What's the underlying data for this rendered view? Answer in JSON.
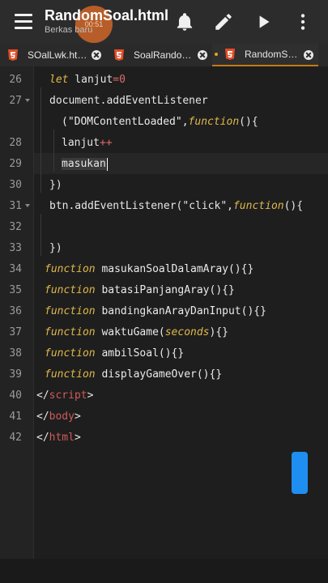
{
  "appbar": {
    "title": "RandomSoal.html",
    "subtitle": "Berkas baru",
    "timer": "00:51"
  },
  "tabs": [
    {
      "label": "SOalLwk.ht…",
      "active": false
    },
    {
      "label": "SoalRando…",
      "active": false
    },
    {
      "label": "RandomS…",
      "active": true
    }
  ],
  "lines": [
    {
      "n": "26"
    },
    {
      "n": "27"
    },
    {
      "n": ""
    },
    {
      "n": "28"
    },
    {
      "n": "29"
    },
    {
      "n": "30"
    },
    {
      "n": "31"
    },
    {
      "n": "32"
    },
    {
      "n": "33"
    },
    {
      "n": "34"
    },
    {
      "n": "35"
    },
    {
      "n": "36"
    },
    {
      "n": "37"
    },
    {
      "n": "38"
    },
    {
      "n": "39"
    },
    {
      "n": "40"
    },
    {
      "n": "41"
    },
    {
      "n": "42"
    }
  ],
  "code": {
    "l26": {
      "kw": "let",
      "name": " lanjut",
      "op": "=",
      "num": "0"
    },
    "l27": {
      "obj": "document.addEventListener"
    },
    "l27b": {
      "str": "(\"DOMContentLoaded\",",
      "kw": "function",
      "rest": "(){"
    },
    "l28": {
      "name": "lanjut",
      "op": "++"
    },
    "l29": {
      "name": "masukan"
    },
    "l30": {
      "text": "})"
    },
    "l31": {
      "pre": "btn.addEventListener(\"click\",",
      "kw": "function",
      "rest": "(){"
    },
    "l33": {
      "text": "})"
    },
    "l34": {
      "kw": "function",
      "name": " masukanSoalDalamAray(){}"
    },
    "l35": {
      "kw": "function",
      "name": " batasiPanjangAray(){}"
    },
    "l36": {
      "kw": "function",
      "name": " bandingkanArayDanInput(){}"
    },
    "l37": {
      "kw": "function",
      "name": " waktuGame(",
      "param": "seconds",
      "rest": "){}"
    },
    "l38": {
      "kw": "function",
      "name": " ambilSoal(){}"
    },
    "l39": {
      "kw": "function",
      "name": " displayGameOver(){}"
    },
    "l40": {
      "open": "</",
      "tag": "script",
      "close": ">"
    },
    "l41": {
      "open": "</",
      "tag": "body",
      "close": ">"
    },
    "l42": {
      "open": "</",
      "tag": "html",
      "close": ">"
    }
  },
  "colors": {
    "accent": "#1f8ef1",
    "tab_indicator": "#c47a12",
    "keyword": "#e0b84a",
    "tag": "#d05a5a"
  }
}
